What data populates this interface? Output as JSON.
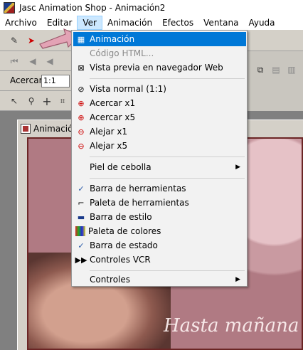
{
  "window": {
    "title": "Jasc Animation Shop - Animación2"
  },
  "menubar": {
    "items": [
      "Archivo",
      "Editar",
      "Ver",
      "Animación",
      "Efectos",
      "Ventana",
      "Ayuda"
    ]
  },
  "toolbar": {
    "zoom_label": "Acercar:",
    "zoom_value": "1:1"
  },
  "document": {
    "title": "Animació"
  },
  "canvas": {
    "script_text": "Hasta mañana"
  },
  "ver_menu": {
    "animacion": "Animación",
    "codigo_html": "Código HTML...",
    "vista_previa": "Vista previa en navegador Web",
    "vista_normal": "Vista normal (1:1)",
    "acercar_x1": "Acercar x1",
    "acercar_x5": "Acercar x5",
    "alejar_x1": "Alejar x1",
    "alejar_x5": "Alejar x5",
    "piel_cebolla": "Piel de cebolla",
    "barra_herramientas": "Barra de herramientas",
    "paleta_herramientas": "Paleta de herramientas",
    "barra_estilo": "Barra de estilo",
    "paleta_colores": "Paleta de colores",
    "barra_estado": "Barra de estado",
    "controles_vcr": "Controles VCR",
    "controles": "Controles"
  },
  "colors": {
    "highlight": "#0078d7",
    "menu_active": "#cce8ff",
    "frame": "#6b2525"
  }
}
